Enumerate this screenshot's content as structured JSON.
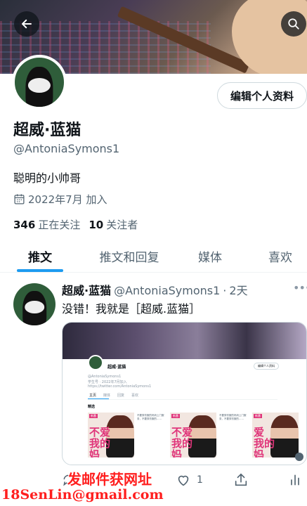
{
  "header": {
    "back_icon": "arrow-left-icon",
    "search_icon": "search-icon"
  },
  "profile": {
    "edit_label": "编辑个人资料",
    "name": "超威·蓝猫",
    "handle": "@AntoniaSymons1",
    "bio": "聪明的小帅哥",
    "joined": "2022年7月 加入",
    "following_count": "346",
    "following_label": "正在关注",
    "followers_count": "10",
    "followers_label": "关注者"
  },
  "tabs": [
    {
      "label": "推文",
      "active": true
    },
    {
      "label": "推文和回复",
      "active": false
    },
    {
      "label": "媒体",
      "active": false
    },
    {
      "label": "喜欢",
      "active": false
    }
  ],
  "tweet": {
    "name": "超威·蓝猫",
    "handle": "@AntoniaSymons1",
    "dot": "·",
    "time": "2天",
    "more": "•••",
    "text": "没错！我就是［超威.蓝猫］",
    "media": {
      "mini_name": "超威·蓝猫",
      "mini_handle": "@AntoniaSymons1",
      "mini_bio": "学生号 · 2022年7月加入",
      "mini_link": "https://twitter.com/AntoniaSymons1",
      "mini_edit": "编辑个人资料",
      "mini_tabs": [
        "主页",
        "媒体",
        "回复",
        "喜欢"
      ],
      "mini_section": "精选",
      "cards": [
        {
          "tag": "新番",
          "big": "不爱\n我的\n妈"
        },
        {
          "tag": "新番",
          "big": "不爱\n我的\n妈"
        },
        {
          "tag": "新番",
          "big": "爱\n我的\n妈"
        }
      ],
      "mini_card_text": "不要穿衣服的妈妈上门服务，不要穿衣服的……"
    },
    "like_count": "1"
  },
  "watermark": {
    "line1": "发邮件获网址",
    "line2": "18SenLin@gmail.com"
  },
  "colors": {
    "accent": "#1d9bf0",
    "text": "#0f1419",
    "secondary": "#536471",
    "watermark": "#ff1e1e"
  }
}
